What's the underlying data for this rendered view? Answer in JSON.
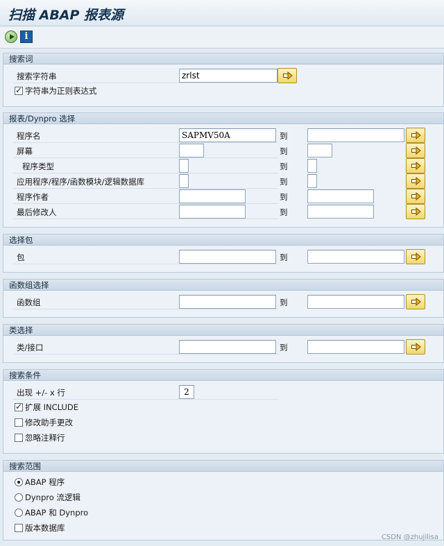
{
  "window": {
    "title": "扫描 ABAP 报表源"
  },
  "toolbar": {
    "execute_icon": "execute-icon",
    "info_icon": "info-icon",
    "info_glyph": "i"
  },
  "groups": {
    "search_term": {
      "title": "搜索词",
      "search_string_label": "搜索字符串",
      "search_string_value": "zrlst",
      "regex_label": "字符串为正则表达式",
      "regex_checked": true
    },
    "report_selection": {
      "title": "报表/Dynpro 选择",
      "to_label": "到",
      "rows": [
        {
          "label": "程序名",
          "from": "SAPMV50A",
          "to": ""
        },
        {
          "label": "屏幕",
          "from": "",
          "to": ""
        },
        {
          "label": "程序类型",
          "from": "",
          "to": ""
        },
        {
          "label": "应用程序/程序/函数模块/逻辑数据库",
          "from": "",
          "to": ""
        },
        {
          "label": "程序作者",
          "from": "",
          "to": ""
        },
        {
          "label": "最后修改人",
          "from": "",
          "to": ""
        }
      ]
    },
    "package": {
      "title": "选择包",
      "label": "包",
      "to_label": "到",
      "from": "",
      "to": ""
    },
    "function_group": {
      "title": "函数组选择",
      "label": "函数组",
      "to_label": "到",
      "from": "",
      "to": ""
    },
    "class": {
      "title": "类选择",
      "label": "类/接口",
      "to_label": "到",
      "from": "",
      "to": ""
    },
    "conditions": {
      "title": "搜索条件",
      "lines_label": "出现 +/- x 行",
      "lines_value": "2",
      "options": [
        {
          "label": "扩展 INCLUDE",
          "checked": true
        },
        {
          "label": "修改助手更改",
          "checked": false
        },
        {
          "label": "忽略注释行",
          "checked": false
        }
      ]
    },
    "scope": {
      "title": "搜索范围",
      "radios": [
        {
          "label": "ABAP 程序",
          "selected": true
        },
        {
          "label": "Dynpro 流逻辑",
          "selected": false
        },
        {
          "label": "ABAP 和 Dynpro",
          "selected": false
        }
      ],
      "version_db_label": "版本数据库",
      "version_db_checked": false
    }
  },
  "watermark": "CSDN @zhujilisa",
  "colors": {
    "background": "#e3ebf3",
    "group_header": "#cad8e6",
    "button_yellow": "#f2d86f"
  }
}
